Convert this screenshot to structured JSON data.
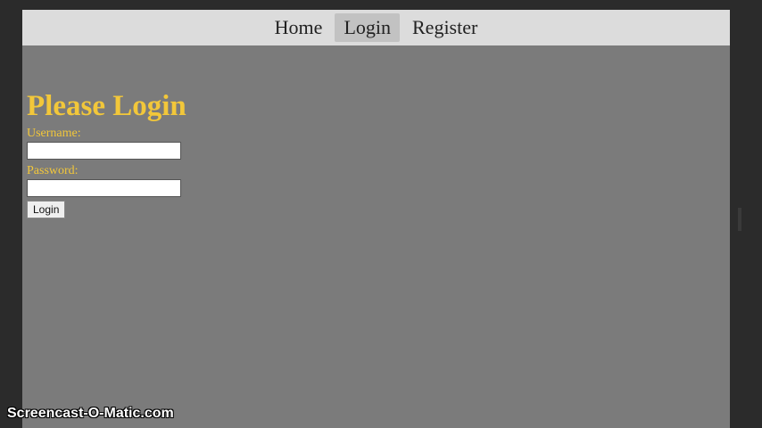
{
  "nav": {
    "items": [
      {
        "label": "Home",
        "active": false
      },
      {
        "label": "Login",
        "active": true
      },
      {
        "label": "Register",
        "active": false
      }
    ]
  },
  "form": {
    "heading": "Please Login",
    "username_label": "Username:",
    "username_value": "",
    "password_label": "Password:",
    "password_value": "",
    "submit_label": "Login"
  },
  "watermark": "Screencast-O-Matic.com",
  "colors": {
    "heading": "#f2c73a",
    "page_background": "#7b7b7b",
    "navbar_background": "#dcdcdc",
    "active_nav_background": "#c2c2c2"
  }
}
